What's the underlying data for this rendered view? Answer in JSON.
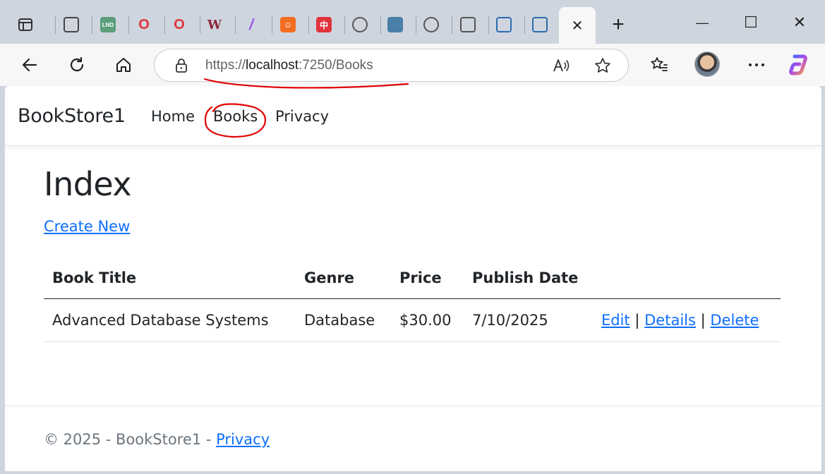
{
  "browser": {
    "tabs": [
      {
        "icon": "window-icon",
        "glyph": "",
        "bg": "transparent",
        "color": "#333"
      },
      {
        "icon": "tab-grid-icon",
        "glyph": "",
        "bg": "transparent",
        "color": "#444"
      },
      {
        "icon": "lnd-icon",
        "glyph": "LND",
        "bg": "#5a9e7a",
        "color": "#fff"
      },
      {
        "icon": "opera-icon",
        "glyph": "O",
        "bg": "transparent",
        "color": "#e0333c"
      },
      {
        "icon": "opera-icon",
        "glyph": "O",
        "bg": "transparent",
        "color": "#e0333c"
      },
      {
        "icon": "w-icon",
        "glyph": "W",
        "bg": "transparent",
        "color": "#8b2b3b"
      },
      {
        "icon": "wand-icon",
        "glyph": "/",
        "bg": "transparent",
        "color": "#9b5de5"
      },
      {
        "icon": "plug-icon",
        "glyph": "☺",
        "bg": "#f26d21",
        "color": "#fff"
      },
      {
        "icon": "chinese-char-icon",
        "glyph": "中",
        "bg": "#e0333c",
        "color": "#fff"
      },
      {
        "icon": "globe-icon",
        "glyph": "",
        "bg": "transparent",
        "color": "#555"
      },
      {
        "icon": "app-icon",
        "glyph": "",
        "bg": "#4a7fa8",
        "color": "#fff"
      },
      {
        "icon": "globe-icon",
        "glyph": "",
        "bg": "transparent",
        "color": "#555"
      },
      {
        "icon": "blocked-page-icon",
        "glyph": "",
        "bg": "transparent",
        "color": "#555"
      },
      {
        "icon": "doc-icon",
        "glyph": "",
        "bg": "transparent",
        "color": "#2b6cb0"
      },
      {
        "icon": "doc-icon",
        "glyph": "",
        "bg": "transparent",
        "color": "#2b6cb0"
      }
    ],
    "active_tab_close": "✕",
    "new_tab": "+",
    "window_controls": {
      "minimize": "—",
      "maximize": "☐",
      "close": "✕"
    },
    "url": {
      "scheme": "https://",
      "host": "localhost",
      "rest": ":7250/Books"
    }
  },
  "site": {
    "brand": "BookStore1",
    "nav": [
      {
        "label": "Home"
      },
      {
        "label": "Books"
      },
      {
        "label": "Privacy"
      }
    ],
    "heading": "Index",
    "create_new": "Create New",
    "table": {
      "headers": [
        "Book Title",
        "Genre",
        "Price",
        "Publish Date",
        ""
      ],
      "rows": [
        {
          "title": "Advanced Database Systems",
          "genre": "Database",
          "price": "$30.00",
          "date": "7/10/2025",
          "edit": "Edit",
          "sep": "|",
          "details": "Details",
          "delete": "Delete"
        }
      ]
    },
    "footer": {
      "text": "© 2025 - BookStore1 - ",
      "privacy": "Privacy"
    }
  },
  "colors": {
    "link": "#0d6efd",
    "annotation": "#e00000"
  }
}
